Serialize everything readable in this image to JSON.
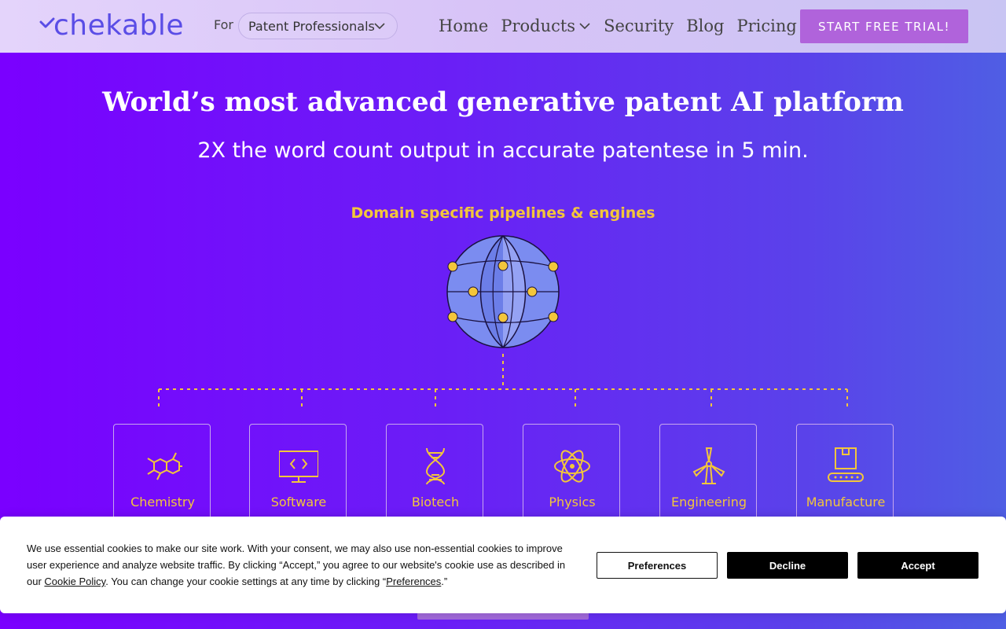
{
  "header": {
    "logo_text": "chekable",
    "for_label": "For",
    "audience_selected": "Patent Professionals",
    "nav": [
      "Home",
      "Products",
      "Security",
      "Blog",
      "Pricing"
    ],
    "cta_label": "START FREE TRIAL!"
  },
  "hero": {
    "title": "World’s most advanced generative patent AI platform",
    "subtitle": "2X the word count output in accurate patentese in 5 min.",
    "pipeline_title": "Domain specific pipelines & engines"
  },
  "domains": [
    {
      "label": "Chemistry",
      "icon": "molecule-icon"
    },
    {
      "label": "Software",
      "icon": "code-monitor-icon"
    },
    {
      "label": "Biotech",
      "icon": "dna-icon"
    },
    {
      "label": "Physics",
      "icon": "atom-icon"
    },
    {
      "label": "Engineering",
      "icon": "wind-turbine-icon"
    },
    {
      "label": "Manufacture",
      "icon": "conveyor-box-icon"
    }
  ],
  "cookie": {
    "text_1": "We use essential cookies to make our site work. With your consent, we may also use non-essential cookies to improve user experience and analyze website traffic. By clicking “Accept,” you agree to our website's cookie use as described in our ",
    "link_policy": "Cookie Policy",
    "text_2": ". You can change your cookie settings at any time by clicking “",
    "link_preferences": "Preferences",
    "text_3": ".”",
    "preferences_button": "Preferences",
    "decline_button": "Decline",
    "accept_button": "Accept"
  },
  "colors": {
    "accent_yellow": "#f3c63b",
    "cta_purple": "#b063db",
    "logo_blue": "#5a4de6"
  }
}
